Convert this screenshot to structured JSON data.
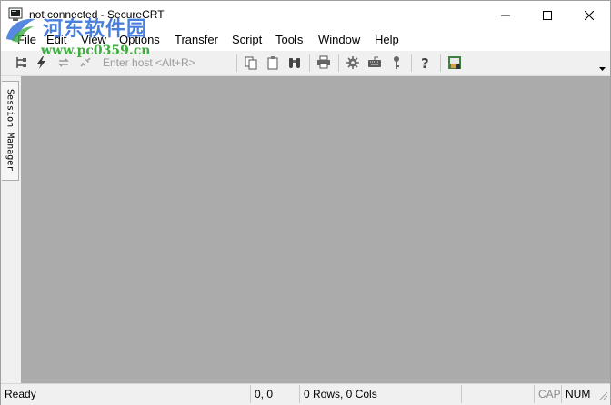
{
  "window": {
    "title": "not connected - SecureCRT"
  },
  "watermark": {
    "chinese": "河东软件园",
    "url": "www.pc0359.cn"
  },
  "menu": {
    "items": [
      "File",
      "Edit",
      "View",
      "Options",
      "Transfer",
      "Script",
      "Tools",
      "Window",
      "Help"
    ]
  },
  "toolbar": {
    "host_placeholder": "Enter host <Alt+R>",
    "icons": [
      "connect-tree-icon",
      "quick-connect-icon",
      "reconnect-icon",
      "disconnect-icon",
      "copy-icon",
      "paste-icon",
      "find-icon",
      "print-icon",
      "settings-icon",
      "keymap-icon",
      "key-icon",
      "help-icon",
      "sftp-icon"
    ]
  },
  "side": {
    "session_manager": "Session Manager"
  },
  "status": {
    "ready": "Ready",
    "position": "0, 0",
    "size": "0 Rows, 0 Cols",
    "cap": "CAP",
    "num": "NUM"
  },
  "colors": {
    "workspace": "#ababab",
    "chrome": "#f0f0f0",
    "watermark_blue": "#2b6ad8",
    "watermark_green": "#2aa62a"
  }
}
